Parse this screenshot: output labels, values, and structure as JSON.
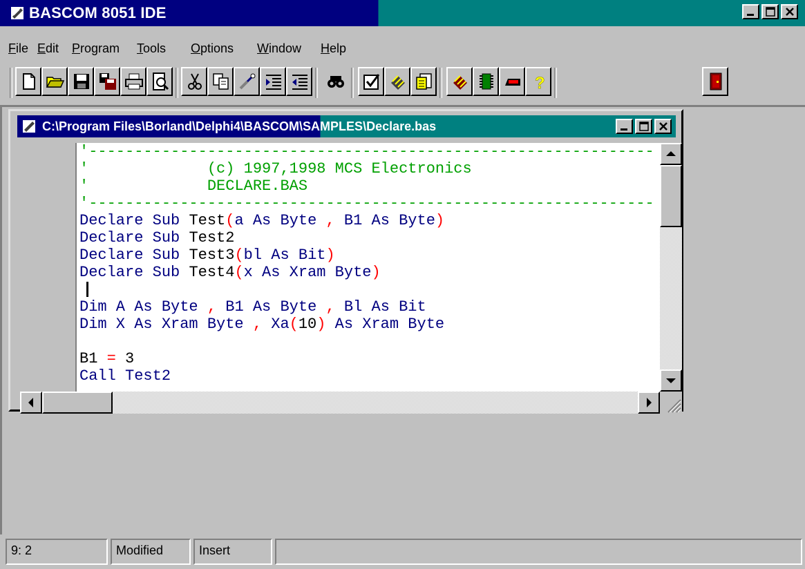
{
  "app": {
    "title": "BASCOM 8051 IDE",
    "colors": {
      "titlebar_active": "#000080",
      "titlebar_gradient": "#008080",
      "face": "#c0c0c0"
    }
  },
  "menu": [
    {
      "label": "File",
      "mnemonic": "F",
      "rest": "ile"
    },
    {
      "label": "Edit",
      "mnemonic": "E",
      "rest": "dit"
    },
    {
      "label": "Program",
      "mnemonic": "P",
      "rest": "rogram"
    },
    {
      "label": "Tools",
      "mnemonic": "T",
      "rest": "ools"
    },
    {
      "label": "Options",
      "mnemonic": "O",
      "rest": "ptions"
    },
    {
      "label": "Window",
      "mnemonic": "W",
      "rest": "indow"
    },
    {
      "label": "Help",
      "mnemonic": "H",
      "rest": "elp"
    }
  ],
  "toolbar": {
    "buttons": [
      {
        "icon": "new-file-icon"
      },
      {
        "icon": "open-folder-icon"
      },
      {
        "icon": "save-icon"
      },
      {
        "icon": "save-as-icon"
      },
      {
        "icon": "print-icon"
      },
      {
        "icon": "print-preview-icon"
      },
      {
        "icon": "cut-icon"
      },
      {
        "icon": "copy-icon"
      },
      {
        "icon": "paste-icon"
      },
      {
        "icon": "indent-icon"
      },
      {
        "icon": "unindent-icon"
      },
      {
        "icon": "find-icon"
      },
      {
        "icon": "syntax-check-icon"
      },
      {
        "icon": "compile-icon"
      },
      {
        "icon": "show-result-icon"
      },
      {
        "icon": "simulate-icon"
      },
      {
        "icon": "program-chip-icon"
      },
      {
        "icon": "terminal-icon"
      },
      {
        "icon": "help-icon"
      },
      {
        "icon": "exit-icon"
      }
    ]
  },
  "document": {
    "title": "C:\\Program Files\\Borland\\Delphi4\\BASCOM\\SAMPLES\\Declare.bas",
    "code": {
      "comment_rule": "'--------------------------------------------------------------",
      "comment_copyright_prefix": "'",
      "comment_copyright": "(c) 1997,1998 MCS Electronics",
      "comment_filename_prefix": "'",
      "comment_filename": "DECLARE.BAS",
      "l1": {
        "a": "Declare Sub ",
        "b": "Test",
        "c": "(",
        "d": "a As Byte ",
        "e": ",",
        "f": " B1 As Byte",
        "g": ")"
      },
      "l2": {
        "a": "Declare Sub ",
        "b": "Test2"
      },
      "l3": {
        "a": "Declare Sub ",
        "b": "Test3",
        "c": "(",
        "d": "bl As Bit",
        "e": ")"
      },
      "l4": {
        "a": "Declare Sub ",
        "b": "Test4",
        "c": "(",
        "d": "x As Xram Byte",
        "e": ")"
      },
      "l6": {
        "a": "Dim A As Byte ",
        "b": ",",
        "c": " B1 As Byte ",
        "d": ",",
        "e": " Bl As Bit"
      },
      "l7": {
        "a": "Dim X As Xram Byte ",
        "b": ",",
        "c": " Xa",
        "d": "(",
        "e": "10",
        "f": ")",
        "g": " As Xram Byte"
      },
      "l9": {
        "a": "B1 ",
        "b": "=",
        "c": " 3"
      },
      "l10": {
        "a": "Call Test2"
      }
    }
  },
  "status": {
    "position": "9: 2",
    "modified": "Modified",
    "mode": "Insert"
  }
}
